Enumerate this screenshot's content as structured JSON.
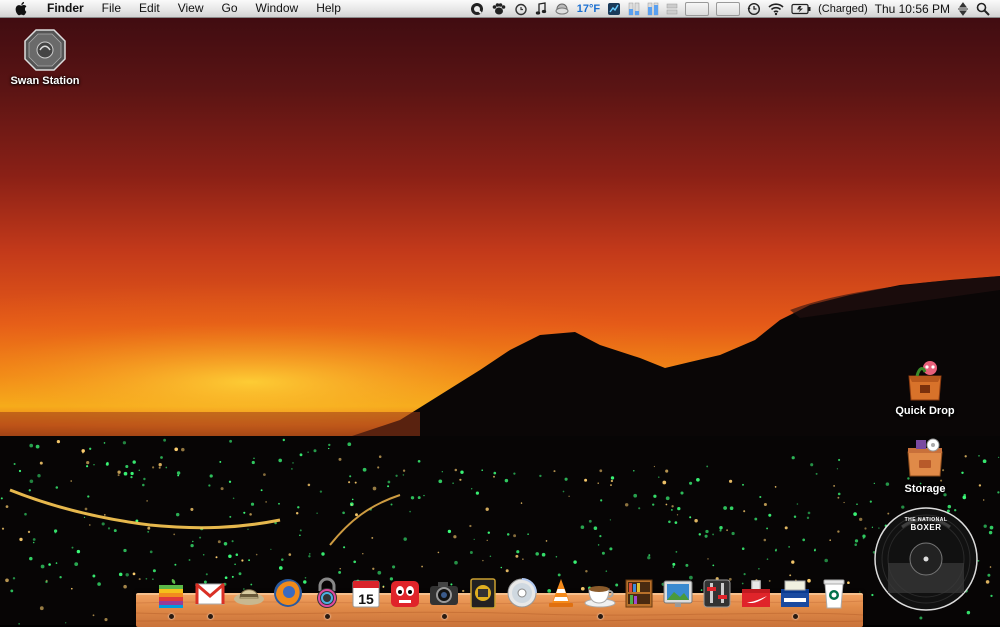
{
  "menubar": {
    "app_name": "Finder",
    "menus": [
      "File",
      "Edit",
      "View",
      "Go",
      "Window",
      "Help"
    ],
    "temperature": "17°F",
    "battery_status": "(Charged)",
    "clock": "Thu 10:56 PM"
  },
  "desktop": {
    "icons": [
      {
        "label": "Swan Station"
      },
      {
        "label": "Quick Drop"
      },
      {
        "label": "Storage"
      }
    ]
  },
  "now_playing": {
    "album_title_line1": "THE NATIONAL",
    "album_title_line2": "BOXER"
  },
  "dock": {
    "items": [
      {
        "icon": "apple-rainbow-icon"
      },
      {
        "icon": "gmail-icon"
      },
      {
        "icon": "safari-hat-icon"
      },
      {
        "icon": "firefox-icon"
      },
      {
        "icon": "itunes-lock-icon"
      },
      {
        "icon": "ical-icon",
        "text": "15"
      },
      {
        "icon": "red-monster-icon"
      },
      {
        "icon": "camera-icon"
      },
      {
        "icon": "photo-booth-icon"
      },
      {
        "icon": "cd-icon"
      },
      {
        "icon": "vlc-cone-icon"
      },
      {
        "icon": "coffee-cup-icon"
      },
      {
        "icon": "books-shelf-icon"
      },
      {
        "icon": "preview-icon"
      },
      {
        "icon": "system-prefs-icon"
      },
      {
        "icon": "nike-box-icon"
      },
      {
        "icon": "reebok-box-icon"
      },
      {
        "icon": "starbucks-cup-icon"
      }
    ],
    "running": [
      0,
      1,
      4,
      7,
      11,
      16
    ]
  },
  "colors": {
    "sky_top": "#3a0a10",
    "sky_glow": "#f8b81a",
    "shelf": "#e08a48",
    "city_lights": "#3cff7a"
  }
}
